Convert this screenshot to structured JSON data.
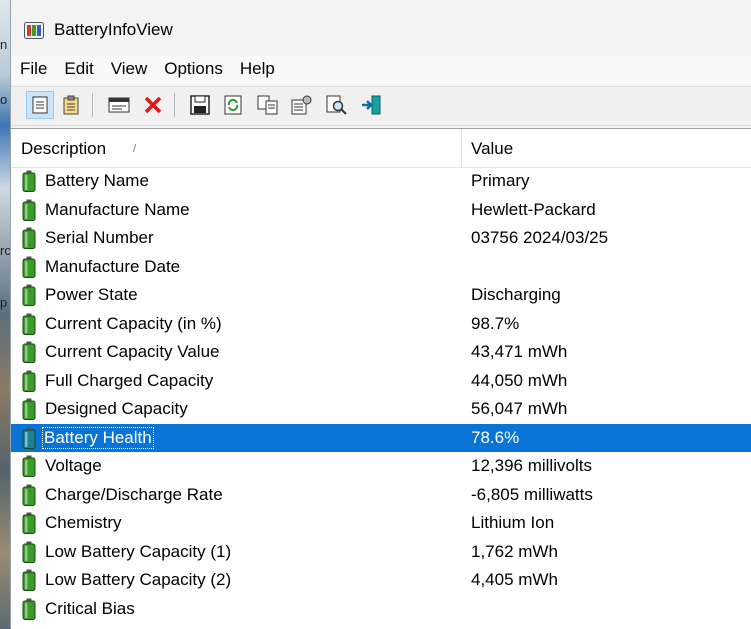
{
  "desktop": {
    "snippets": [
      "n",
      "o",
      "rc",
      "p"
    ]
  },
  "window": {
    "title": "BatteryInfoView"
  },
  "menu": [
    "File",
    "Edit",
    "View",
    "Options",
    "Help"
  ],
  "toolbar": {
    "buttons": [
      {
        "icon": "properties-list-icon"
      },
      {
        "icon": "clipboard-icon"
      },
      {
        "icon": "window-view-icon"
      },
      {
        "icon": "delete-icon"
      },
      {
        "icon": "save-icon"
      },
      {
        "icon": "refresh-icon"
      },
      {
        "icon": "copy-icon"
      },
      {
        "icon": "properties-icon"
      },
      {
        "icon": "find-icon"
      },
      {
        "icon": "exit-icon"
      }
    ]
  },
  "table": {
    "columns": [
      "Description",
      "Value"
    ],
    "sort_indicator": "/",
    "selected_index": 9,
    "rows": [
      {
        "desc": "Battery Name",
        "value": "Primary"
      },
      {
        "desc": "Manufacture Name",
        "value": "Hewlett-Packard"
      },
      {
        "desc": "Serial Number",
        "value": "03756 2024/03/25"
      },
      {
        "desc": "Manufacture Date",
        "value": ""
      },
      {
        "desc": "Power State",
        "value": "Discharging"
      },
      {
        "desc": "Current Capacity (in %)",
        "value": "98.7%"
      },
      {
        "desc": "Current Capacity Value",
        "value": "43,471 mWh"
      },
      {
        "desc": "Full Charged Capacity",
        "value": "44,050 mWh"
      },
      {
        "desc": "Designed Capacity",
        "value": "56,047 mWh"
      },
      {
        "desc": "Battery Health",
        "value": "78.6%"
      },
      {
        "desc": "Voltage",
        "value": "12,396 millivolts"
      },
      {
        "desc": "Charge/Discharge Rate",
        "value": "-6,805 milliwatts"
      },
      {
        "desc": "Chemistry",
        "value": "Lithium Ion"
      },
      {
        "desc": "Low Battery Capacity (1)",
        "value": "1,762 mWh"
      },
      {
        "desc": "Low Battery Capacity (2)",
        "value": "4,405 mWh"
      },
      {
        "desc": "Critical Bias",
        "value": ""
      }
    ]
  },
  "colors": {
    "selection": "#0a74d6",
    "battery_icon": "#3a9a2a",
    "battery_icon_selected": "#1d7f9a"
  }
}
